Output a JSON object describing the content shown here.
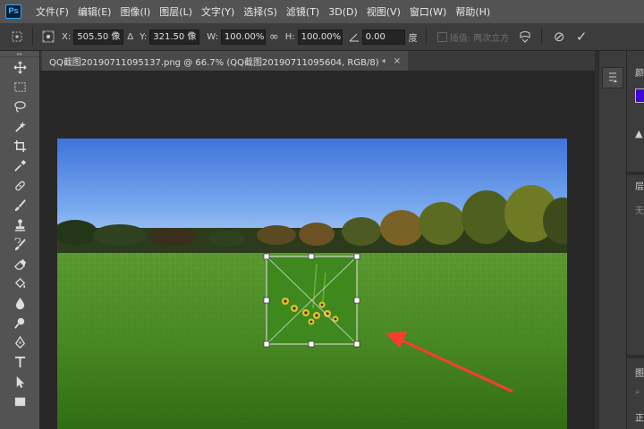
{
  "app": {
    "logo": "Ps"
  },
  "menu": [
    "文件(F)",
    "编辑(E)",
    "图像(I)",
    "图层(L)",
    "文字(Y)",
    "选择(S)",
    "滤镜(T)",
    "3D(D)",
    "视图(V)",
    "窗口(W)",
    "帮助(H)"
  ],
  "options": {
    "x_label": "X:",
    "x_value": "505.50 像",
    "delta_icon": "Δ",
    "y_label": "Y:",
    "y_value": "321.50 像",
    "w_label": "W:",
    "w_value": "100.00%",
    "link_icon": "∞",
    "h_label": "H:",
    "h_value": "100.00%",
    "angle_value": "0.00",
    "angle_unit": "度",
    "interp_label": "插值: 两次立方",
    "cancel_icon": "⊘",
    "commit_icon": "✓"
  },
  "document": {
    "tab_title": "QQ截图20190711095137.png @ 66.7% (QQ截图20190711095604, RGB/8) *",
    "close": "×"
  },
  "panel": {
    "color_label": "颜",
    "layers_label": "层",
    "none_label": "无",
    "third_label": "图",
    "bottom_label": "正"
  },
  "colors": {
    "foreground": "#3d07d7",
    "annotation_arrow": "#ff3b2f"
  }
}
